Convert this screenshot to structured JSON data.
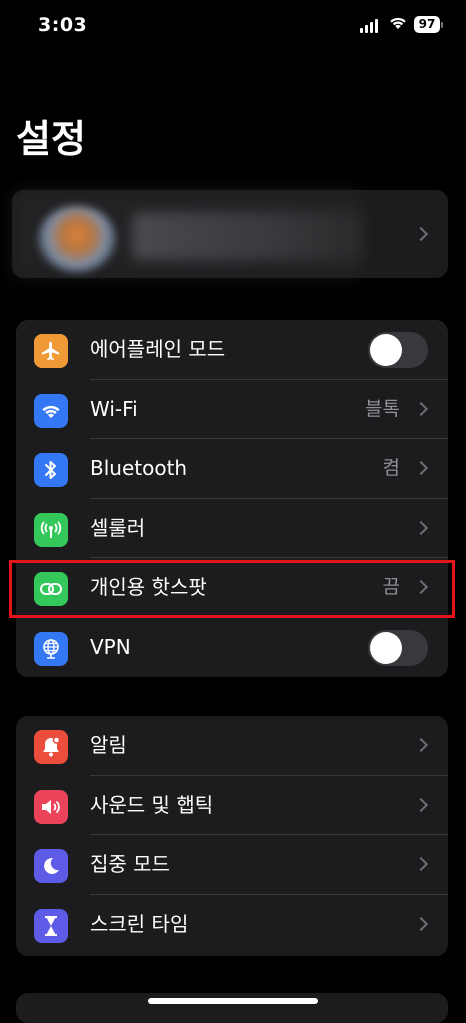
{
  "status_bar": {
    "time": "3:03",
    "battery": "97"
  },
  "page_title": "설정",
  "group1": [
    {
      "label": "에어플레인 모드",
      "icon": "airplane-icon",
      "color": "#f09a37",
      "control": "toggle",
      "on": false
    },
    {
      "label": "Wi-Fi",
      "icon": "wifi-icon",
      "color": "#3478f6",
      "value": "블톡"
    },
    {
      "label": "Bluetooth",
      "icon": "bluetooth-icon",
      "color": "#3478f6",
      "value": "켬"
    },
    {
      "label": "셀룰러",
      "icon": "cellular-icon",
      "color": "#34c759",
      "value": ""
    },
    {
      "label": "개인용 핫스팟",
      "icon": "hotspot-icon",
      "color": "#34c759",
      "value": "끔"
    },
    {
      "label": "VPN",
      "icon": "vpn-globe-icon",
      "color": "#3478f6",
      "control": "toggle",
      "on": false
    }
  ],
  "group2": [
    {
      "label": "알림",
      "icon": "bell-icon",
      "color": "#eb4e3d"
    },
    {
      "label": "사운드 및 햅틱",
      "icon": "speaker-icon",
      "color": "#eb445a"
    },
    {
      "label": "집중 모드",
      "icon": "moon-icon",
      "color": "#5e5ce6"
    },
    {
      "label": "스크린 타임",
      "icon": "hourglass-icon",
      "color": "#5e5ce6"
    }
  ],
  "highlight_color": "#e3151b"
}
